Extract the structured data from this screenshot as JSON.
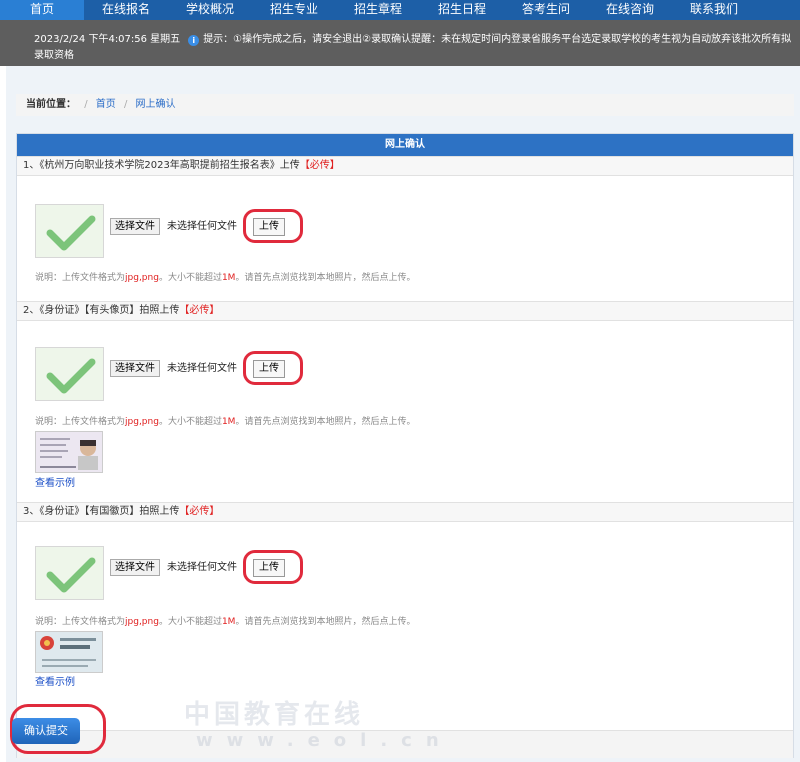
{
  "nav": {
    "items": [
      {
        "label": "首页",
        "active": true
      },
      {
        "label": "在线报名"
      },
      {
        "label": "学校概况"
      },
      {
        "label": "招生专业"
      },
      {
        "label": "招生章程"
      },
      {
        "label": "招生日程"
      },
      {
        "label": "答考生问"
      },
      {
        "label": "在线咨询"
      },
      {
        "label": "联系我们"
      }
    ]
  },
  "notice": {
    "datetime": "2023/2/24 下午4:07:56 星期五",
    "text_line1": "提示：①操作完成之后，请安全退出②录取确认提醒：未在规定时间内登录省服务平台选定录取学校的考生视为自动放弃该批次所有拟",
    "text_line2": "录取资格"
  },
  "breadcrumb": {
    "label": "当前位置：",
    "items": [
      "首页",
      "网上确认"
    ]
  },
  "panel": {
    "title": "网上确认",
    "sections": [
      {
        "title": "1、《杭州万向职业技术学院2023年高职提前招生报名表》上传",
        "required": "【必传】"
      },
      {
        "title": "2、《身份证》【有头像页】拍照上传",
        "required": "【必传】"
      },
      {
        "title": "3、《身份证》【有国徽页】拍照上传",
        "required": "【必传】"
      }
    ],
    "file_button": "选择文件",
    "file_status": "未选择任何文件",
    "upload_button": "上传",
    "note_prefix": "说明：上传文件格式为",
    "note_formats": "jpg,png",
    "note_mid": "。大小不能超过",
    "note_size": "1M",
    "note_suffix": "。请首先点浏览找到本地照片，然后点上传。",
    "sample_link": "查看示例",
    "submit_button": "确认提交"
  },
  "watermark": {
    "line1": "中国教育在线",
    "line2": "www.eol.cn"
  },
  "colors": {
    "nav_bg": "#1d5fa7",
    "nav_active": "#2a7fd4",
    "panel_header": "#2d72c4",
    "required": "#e02020",
    "highlight_ring": "#e02a3c",
    "link": "#1b4fc7"
  }
}
